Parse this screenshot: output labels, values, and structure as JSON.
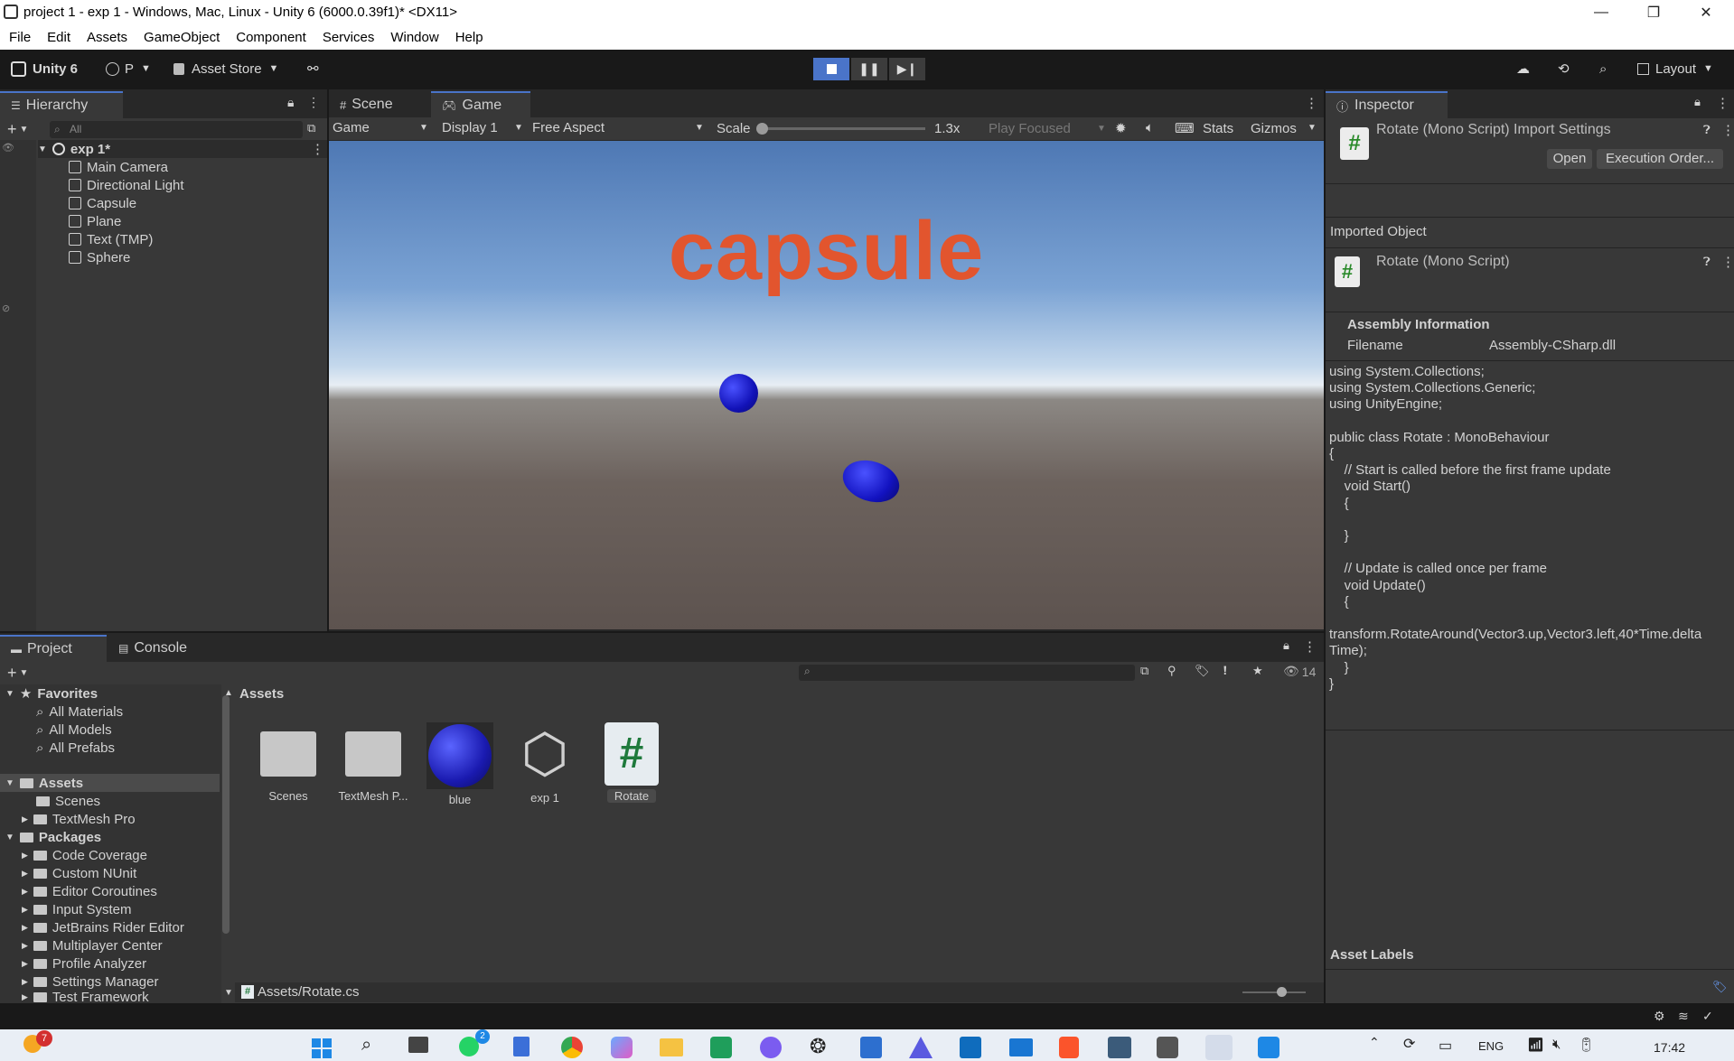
{
  "window": {
    "title": "project 1 - exp 1 - Windows, Mac, Linux - Unity 6 (6000.0.39f1)* <DX11>",
    "minimize": "—",
    "maximize": "❐",
    "close": "✕"
  },
  "menu": [
    "File",
    "Edit",
    "Assets",
    "GameObject",
    "Component",
    "Services",
    "Window",
    "Help"
  ],
  "toolbar": {
    "unity_label": "Unity 6",
    "account": "P",
    "asset_store": "Asset Store",
    "layout": "Layout"
  },
  "hierarchy": {
    "tab": "Hierarchy",
    "search_placeholder": "All",
    "scene": "exp 1*",
    "items": [
      "Main Camera",
      "Directional Light",
      "Capsule",
      "Plane",
      "Text (TMP)",
      "Sphere"
    ]
  },
  "game": {
    "tab_scene": "Scene",
    "tab_game": "Game",
    "mode": "Game",
    "display": "Display 1",
    "aspect": "Free Aspect",
    "scale_label": "Scale",
    "scale_value": "1.3x",
    "play_focused": "Play Focused",
    "stats": "Stats",
    "gizmos": "Gizmos",
    "text_3d": "capsule"
  },
  "inspector": {
    "tab": "Inspector",
    "title": "Rotate (Mono Script) Import Settings",
    "open": "Open",
    "execution_order": "Execution Order...",
    "imported_object": "Imported Object",
    "object_name": "Rotate (Mono Script)",
    "assembly_header": "Assembly Information",
    "filename_label": "Filename",
    "filename_value": "Assembly-CSharp.dll",
    "asset_labels": "Asset Labels",
    "code": "using System.Collections;\nusing System.Collections.Generic;\nusing UnityEngine;\n\npublic class Rotate : MonoBehaviour\n{\n    // Start is called before the first frame update\n    void Start()\n    {\n\n    }\n\n    // Update is called once per frame\n    void Update()\n    {\n\ntransform.RotateAround(Vector3.up,Vector3.left,40*Time.delta\nTime);\n    }\n}"
  },
  "project": {
    "tab_project": "Project",
    "tab_console": "Console",
    "hidden_count": "14",
    "favorites_label": "Favorites",
    "favorites": [
      "All Materials",
      "All Models",
      "All Prefabs"
    ],
    "assets_label": "Assets",
    "asset_folders": [
      "Scenes",
      "TextMesh Pro"
    ],
    "packages_label": "Packages",
    "packages": [
      "Code Coverage",
      "Custom NUnit",
      "Editor Coroutines",
      "Input System",
      "JetBrains Rider Editor",
      "Multiplayer Center",
      "Profile Analyzer",
      "Settings Manager",
      "Test Framework"
    ],
    "breadcrumb": "Assets",
    "grid": [
      "Scenes",
      "TextMesh P...",
      "blue",
      "exp 1",
      "Rotate"
    ],
    "selected_path": "Assets/Rotate.cs"
  },
  "taskbar": {
    "notif_count": "7",
    "chat_badge": "2",
    "lang": "ENG",
    "time": "17:42"
  }
}
